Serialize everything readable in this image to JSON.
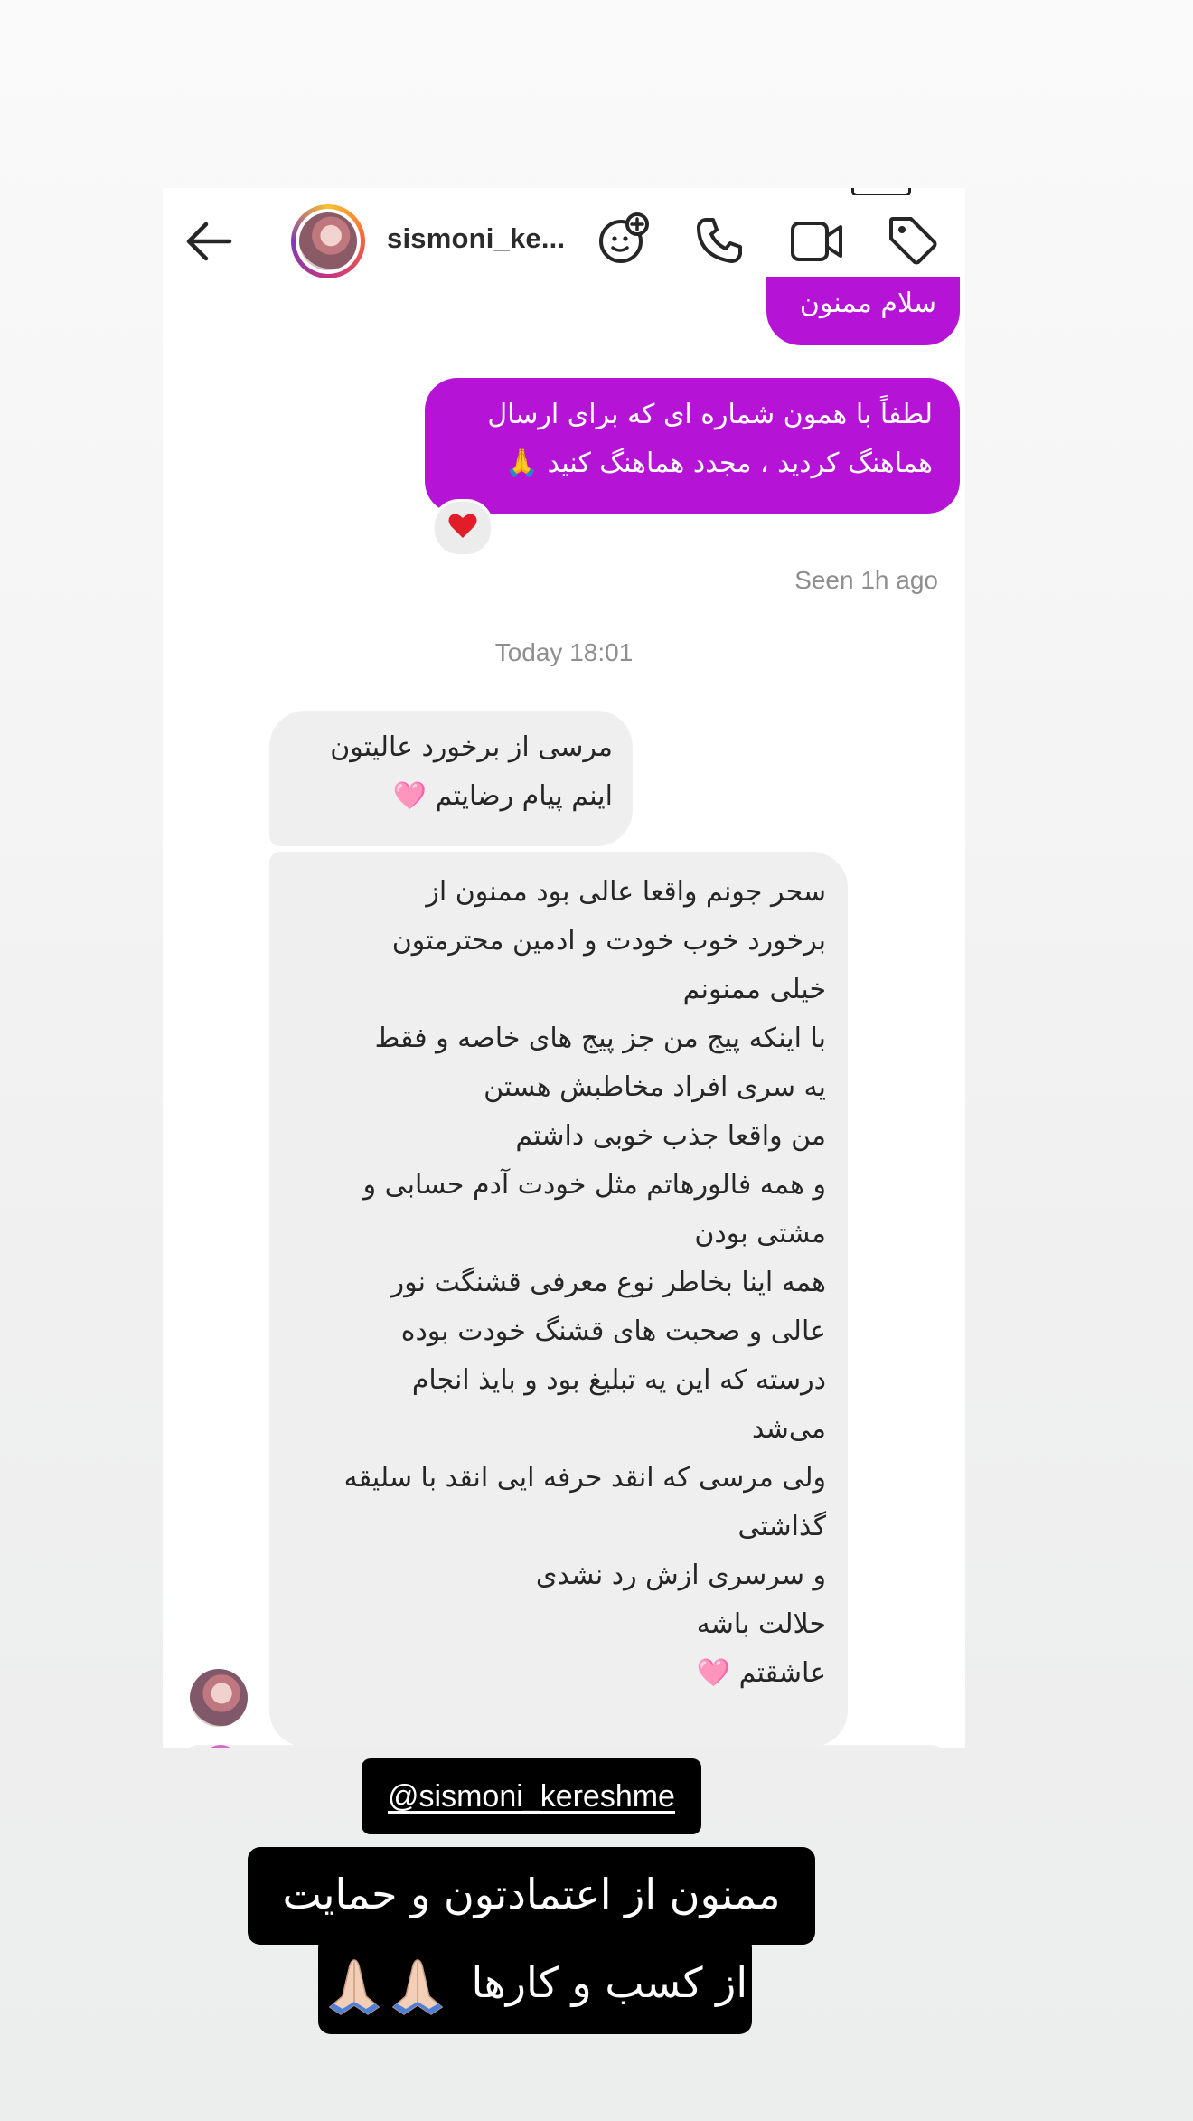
{
  "header": {
    "username": "sismoni_ke...",
    "icons": [
      "back-arrow-icon",
      "effects-icon",
      "phone-icon",
      "video-icon",
      "tag-icon"
    ]
  },
  "messages": [
    {
      "direction": "outgoing",
      "text": "سلام ممنون"
    },
    {
      "direction": "outgoing",
      "text": "لطفاً با همون شماره ای که برای ارسال\nهماهنگ کردید ، مجدد هماهنگ کنید 🙏",
      "reaction": "❤️"
    },
    {
      "direction": "incoming",
      "text": "مرسی از برخورد عالیتون\nاینم پیام رضایتم 🩷"
    },
    {
      "direction": "incoming",
      "text": "سحر جونم واقعا عالی بود ممنون از\nبرخورد خوب خودت و ادمین محترمتون\nخیلی ممنونم\nبا اینکه پیج من جز پیج های خاصه و فقط\nیه سری افراد مخاطبش هستن\nمن واقعا جذب خوبی داشتم\nو همه فالورهاتم مثل خودت آدم حسابی و\nمشتی بودن\nهمه اینا بخاطر نوع معرفی قشنگت نور\nعالی و  صحبت های قشنگ خودت بوده\nدرسته که این یه تبلیغ بود و بایذ انجام\nمی‌شد\nولی مرسی که انقد حرفه ایی انقد با سلیقه\nگذاشتی\nو سرسری ازش رد نشدی\nحلالت باشه\nعاشقتم 🩷"
    }
  ],
  "seen_status": "Seen 1h ago",
  "timestamp": "Today 18:01",
  "overlay": {
    "mention": "@sismoni_kereshme",
    "caption_line1": "ممنون از اعتمادتون و حمایت",
    "caption_line2": "از کسب و کارها"
  },
  "colors": {
    "outgoing_bubble": "#b513d6",
    "incoming_bubble": "#efefef",
    "meta_text": "#8e8e8e"
  }
}
